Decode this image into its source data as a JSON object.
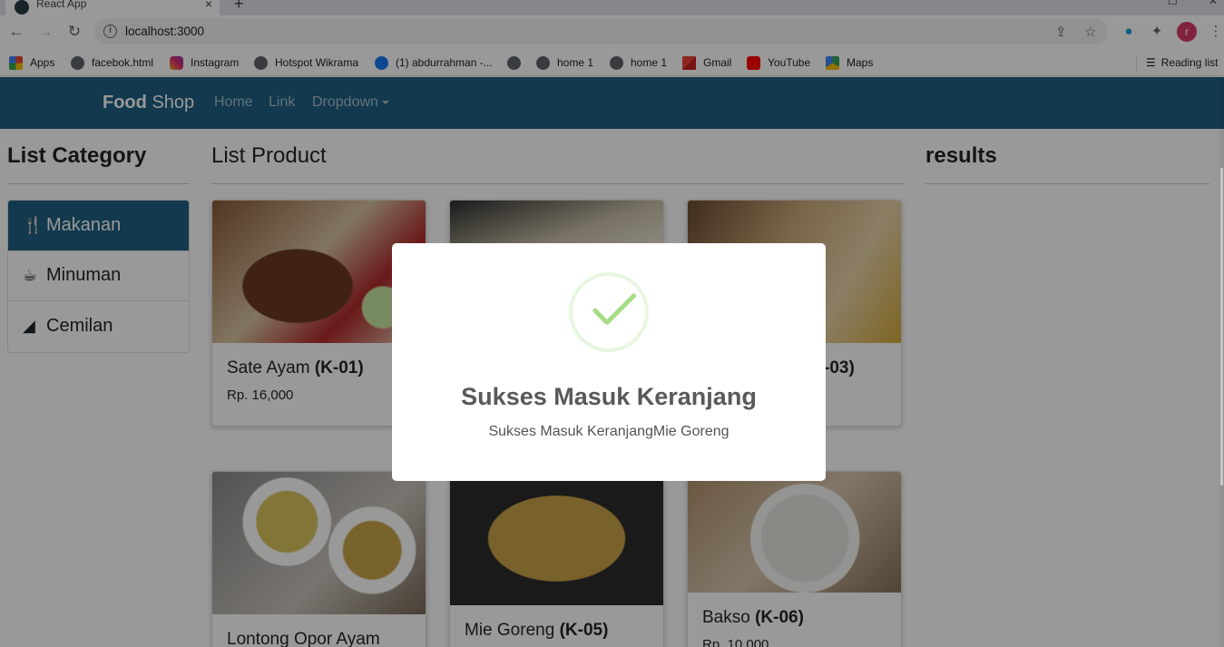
{
  "browser": {
    "tab_title": "React App",
    "url": "localhost:3000",
    "profile_initial": "r",
    "bookmarks": [
      {
        "label": "Apps",
        "icon": "apps-grid-icon"
      },
      {
        "label": "facebok.html",
        "icon": "globe-icon"
      },
      {
        "label": "Instagram",
        "icon": "instagram-icon"
      },
      {
        "label": "Hotspot Wikrama",
        "icon": "globe-icon"
      },
      {
        "label": "(1) abdurrahman -...",
        "icon": "facebook-icon"
      },
      {
        "label": "",
        "icon": "globe-icon"
      },
      {
        "label": "home 1",
        "icon": "globe-icon"
      },
      {
        "label": "home 1",
        "icon": "globe-icon"
      },
      {
        "label": "Gmail",
        "icon": "gmail-icon"
      },
      {
        "label": "YouTube",
        "icon": "youtube-icon"
      },
      {
        "label": "Maps",
        "icon": "maps-icon"
      }
    ],
    "reading_list": "Reading list"
  },
  "navbar": {
    "brand_bold": "Food",
    "brand_rest": "Shop",
    "links": [
      "Home",
      "Link",
      "Dropdown"
    ]
  },
  "categories": {
    "title": "List Category",
    "items": [
      {
        "label": "Makanan",
        "icon": "utensils-icon",
        "active": true
      },
      {
        "label": "Minuman",
        "icon": "coffee-icon",
        "active": false
      },
      {
        "label": "Cemilan",
        "icon": "cheese-icon",
        "active": false
      }
    ]
  },
  "products": {
    "title": "List Product",
    "items": [
      {
        "name": "Sate Ayam",
        "code": "(K-01)",
        "price": "Rp. 16,000"
      },
      {
        "name": "",
        "code": "",
        "price": ""
      },
      {
        "name": "",
        "code": "-03)",
        "price": ""
      },
      {
        "name": "Lontong Opor Ayam",
        "code": "",
        "price": ""
      },
      {
        "name": "Mie Goreng",
        "code": "(K-05)",
        "price": ""
      },
      {
        "name": "Bakso",
        "code": "(K-06)",
        "price": "Rp. 10,000"
      }
    ]
  },
  "results": {
    "title": "results"
  },
  "modal": {
    "title": "Sukses Masuk Keranjang",
    "text": "Sukses Masuk KeranjangMie Goreng",
    "icon": "success-check-icon",
    "accent": "#a5dc86"
  },
  "colors": {
    "navbar": "#1e5f80",
    "active_category": "#1e5f80"
  }
}
